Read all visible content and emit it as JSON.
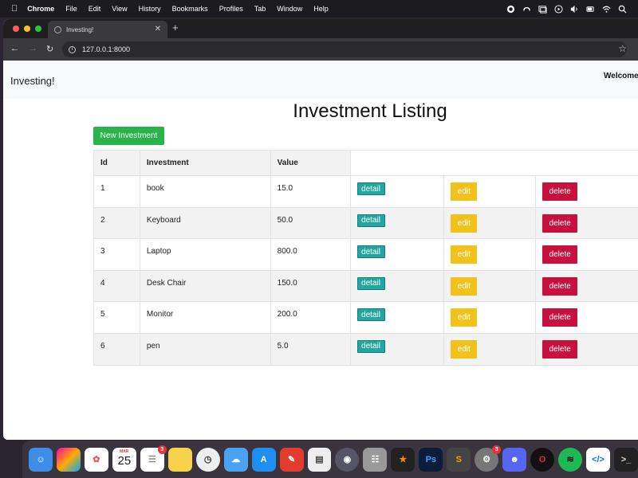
{
  "menubar": {
    "app": "Chrome",
    "items": [
      "File",
      "Edit",
      "View",
      "History",
      "Bookmarks",
      "Profiles",
      "Tab",
      "Window",
      "Help"
    ]
  },
  "browser": {
    "tab_title": "Investing!",
    "url": "127.0.0.1:8000"
  },
  "page": {
    "brand": "Investing!",
    "welcome": "Welcome",
    "title": "Investment Listing",
    "new_button": "New Investment",
    "columns": [
      "Id",
      "Investment",
      "Value"
    ],
    "rows": [
      {
        "id": "1",
        "name": "book",
        "value": "15.0"
      },
      {
        "id": "2",
        "name": "Keyboard",
        "value": "50.0"
      },
      {
        "id": "3",
        "name": "Laptop",
        "value": "800.0"
      },
      {
        "id": "4",
        "name": "Desk Chair",
        "value": "150.0"
      },
      {
        "id": "5",
        "name": "Monitor",
        "value": "200.0"
      },
      {
        "id": "6",
        "name": "pen",
        "value": "5.0"
      }
    ],
    "actions": {
      "detail": "detail",
      "edit": "edit",
      "delete": "delete"
    }
  },
  "dock": {
    "calendar_month": "MAR",
    "calendar_day": "25",
    "reminders_badge": "3",
    "settings_badge": "3",
    "photoshop_label": "Ps"
  },
  "colors": {
    "success": "#28b44a",
    "info": "#22a7a0",
    "warning": "#f2c21b",
    "danger": "#c8103e"
  }
}
